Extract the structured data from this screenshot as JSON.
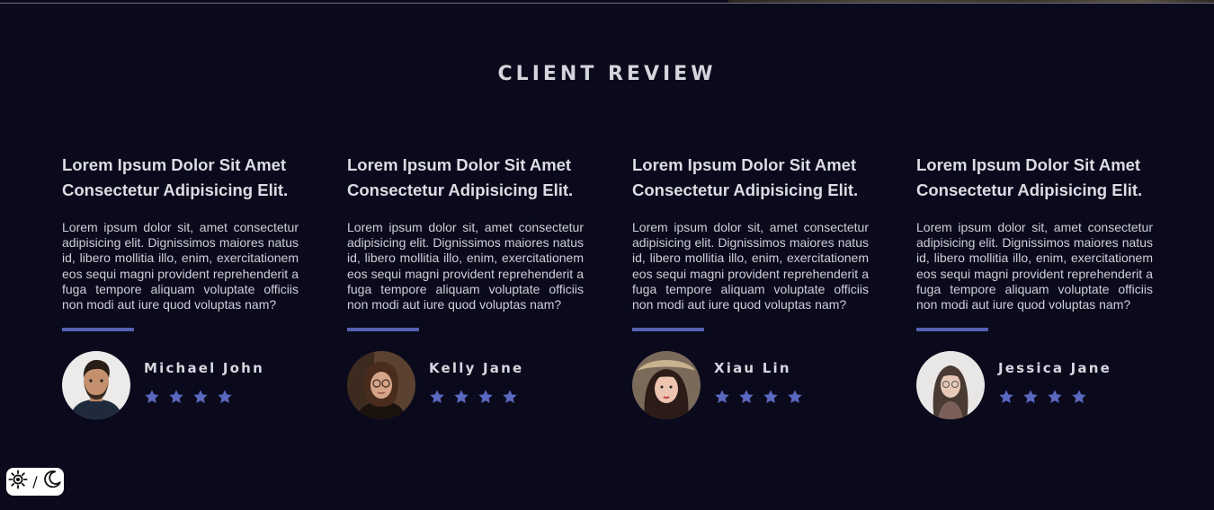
{
  "section": {
    "title": "CLIENT REVIEW"
  },
  "reviews": [
    {
      "title_line1": "Lorem Ipsum Dolor Sit Amet",
      "title_line2": "Consectetur Adipisicing Elit.",
      "text": "Lorem ipsum dolor sit, amet consectetur adipisicing elit. Dignissimos maiores natus id, libero mollitia illo, enim, exercitationem eos sequi magni provident reprehenderit a fuga tempore aliquam voluptate officiis non modi aut iure quod voluptas nam?",
      "author": "Michael John",
      "rating": 4
    },
    {
      "title_line1": "Lorem Ipsum Dolor Sit Amet",
      "title_line2": "Consectetur Adipisicing Elit.",
      "text": "Lorem ipsum dolor sit, amet consectetur adipisicing elit. Dignissimos maiores natus id, libero mollitia illo, enim, exercitationem eos sequi magni provident reprehenderit a fuga tempore aliquam voluptate officiis non modi aut iure quod voluptas nam?",
      "author": "Kelly Jane",
      "rating": 4
    },
    {
      "title_line1": "Lorem Ipsum Dolor Sit Amet",
      "title_line2": "Consectetur Adipisicing Elit.",
      "text": "Lorem ipsum dolor sit, amet consectetur adipisicing elit. Dignissimos maiores natus id, libero mollitia illo, enim, exercitationem eos sequi magni provident reprehenderit a fuga tempore aliquam voluptate officiis non modi aut iure quod voluptas nam?",
      "author": "Xiau Lin",
      "rating": 4
    },
    {
      "title_line1": "Lorem Ipsum Dolor Sit Amet",
      "title_line2": "Consectetur Adipisicing Elit.",
      "text": "Lorem ipsum dolor sit, amet consectetur adipisicing elit. Dignissimos maiores natus id, libero mollitia illo, enim, exercitationem eos sequi magni provident reprehenderit a fuga tempore aliquam voluptate officiis non modi aut iure quod voluptas nam?",
      "author": "Jessica Jane",
      "rating": 4
    }
  ],
  "theme_toggle": {
    "light_icon": "sun-icon",
    "separator": "/",
    "dark_icon": "moon-icon"
  },
  "colors": {
    "background": "#0a0a1c",
    "accent": "#5561b0",
    "star": "#5a68c0",
    "text": "#d9d9e0"
  }
}
